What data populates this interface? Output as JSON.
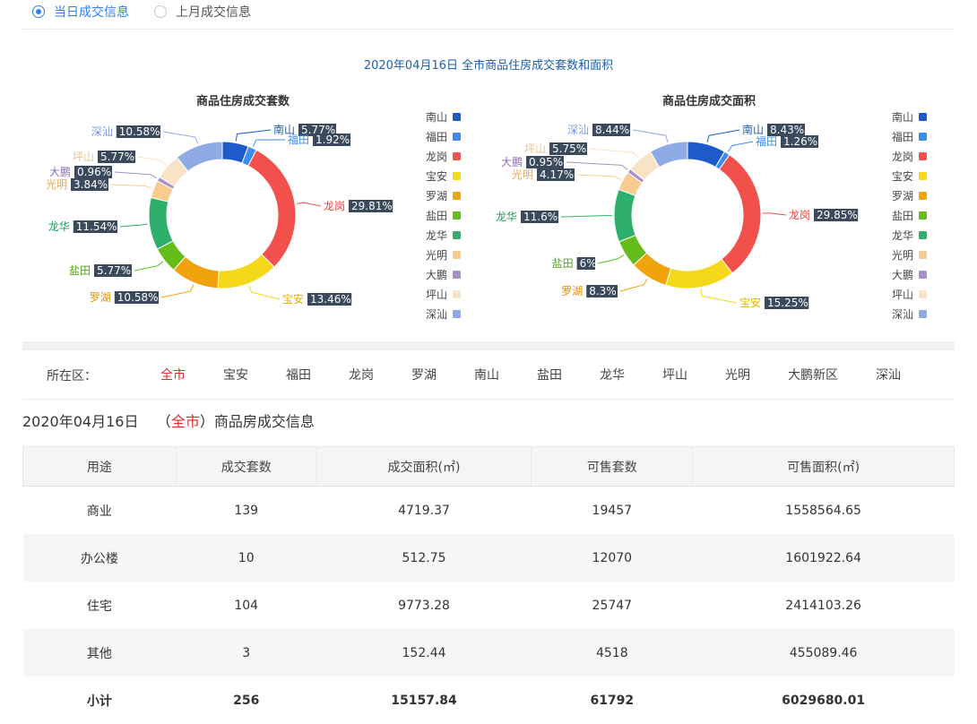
{
  "tabs": [
    {
      "label": "当日成交信息",
      "active": true
    },
    {
      "label": "上月成交信息",
      "active": false
    }
  ],
  "chart_section_title": "2020年04月16日 全市商品住房成交套数和面积",
  "chart_data": [
    {
      "type": "pie",
      "title": "商品住房成交套数",
      "categories": [
        "南山",
        "福田",
        "龙岗",
        "宝安",
        "罗湖",
        "盐田",
        "龙华",
        "光明",
        "大鹏",
        "坪山",
        "深汕"
      ],
      "values": [
        5.77,
        1.92,
        29.81,
        13.46,
        10.58,
        5.77,
        11.54,
        3.84,
        0.96,
        5.77,
        10.58
      ],
      "labels": [
        "5.77%",
        "1.92%",
        "29.81%",
        "13.46%",
        "10.58%",
        "5.77%",
        "11.54%",
        "3.84%",
        "0.96%",
        "5.77%",
        "10.58%"
      ],
      "unit": "%",
      "legend_position": "right"
    },
    {
      "type": "pie",
      "title": "商品住房成交面积",
      "categories": [
        "南山",
        "福田",
        "龙岗",
        "宝安",
        "罗湖",
        "盐田",
        "龙华",
        "光明",
        "大鹏",
        "坪山",
        "深汕"
      ],
      "values": [
        8.43,
        1.26,
        29.85,
        15.25,
        8.3,
        6,
        11.6,
        4.17,
        0.95,
        5.75,
        8.44
      ],
      "labels": [
        "8.43%",
        "1.26%",
        "29.85%",
        "15.25%",
        "8.3%",
        "6%",
        "11.6%",
        "4.17%",
        "0.95%",
        "5.75%",
        "8.44%"
      ],
      "unit": "%",
      "legend_position": "right"
    }
  ],
  "colors": [
    "#1c5bc9",
    "#3b8ef0",
    "#f2504b",
    "#f6d81a",
    "#f0a30a",
    "#64bd1b",
    "#2eaf6b",
    "#f7cc8e",
    "#a98fc9",
    "#f9e3c6",
    "#8fabe6"
  ],
  "district_filter": {
    "label": "所在区：",
    "items": [
      "全市",
      "宝安",
      "福田",
      "龙岗",
      "罗湖",
      "南山",
      "盐田",
      "龙华",
      "坪山",
      "光明",
      "大鹏新区",
      "深汕"
    ],
    "active": "全市"
  },
  "info": {
    "date": "2020年04月16日",
    "open": "（",
    "district": "全市",
    "close": "）",
    "suffix": "商品房成交信息"
  },
  "table": {
    "headers": [
      "用途",
      "成交套数",
      "成交面积(㎡)",
      "可售套数",
      "可售面积(㎡)"
    ],
    "rows": [
      [
        "商业",
        "139",
        "4719.37",
        "19457",
        "1558564.65"
      ],
      [
        "办公楼",
        "10",
        "512.75",
        "12070",
        "1601922.64"
      ],
      [
        "住宅",
        "104",
        "9773.28",
        "25747",
        "2414103.26"
      ],
      [
        "其他",
        "3",
        "152.44",
        "4518",
        "455089.46"
      ]
    ],
    "total": [
      "小计",
      "256",
      "15157.84",
      "61792",
      "6029680.01"
    ]
  }
}
